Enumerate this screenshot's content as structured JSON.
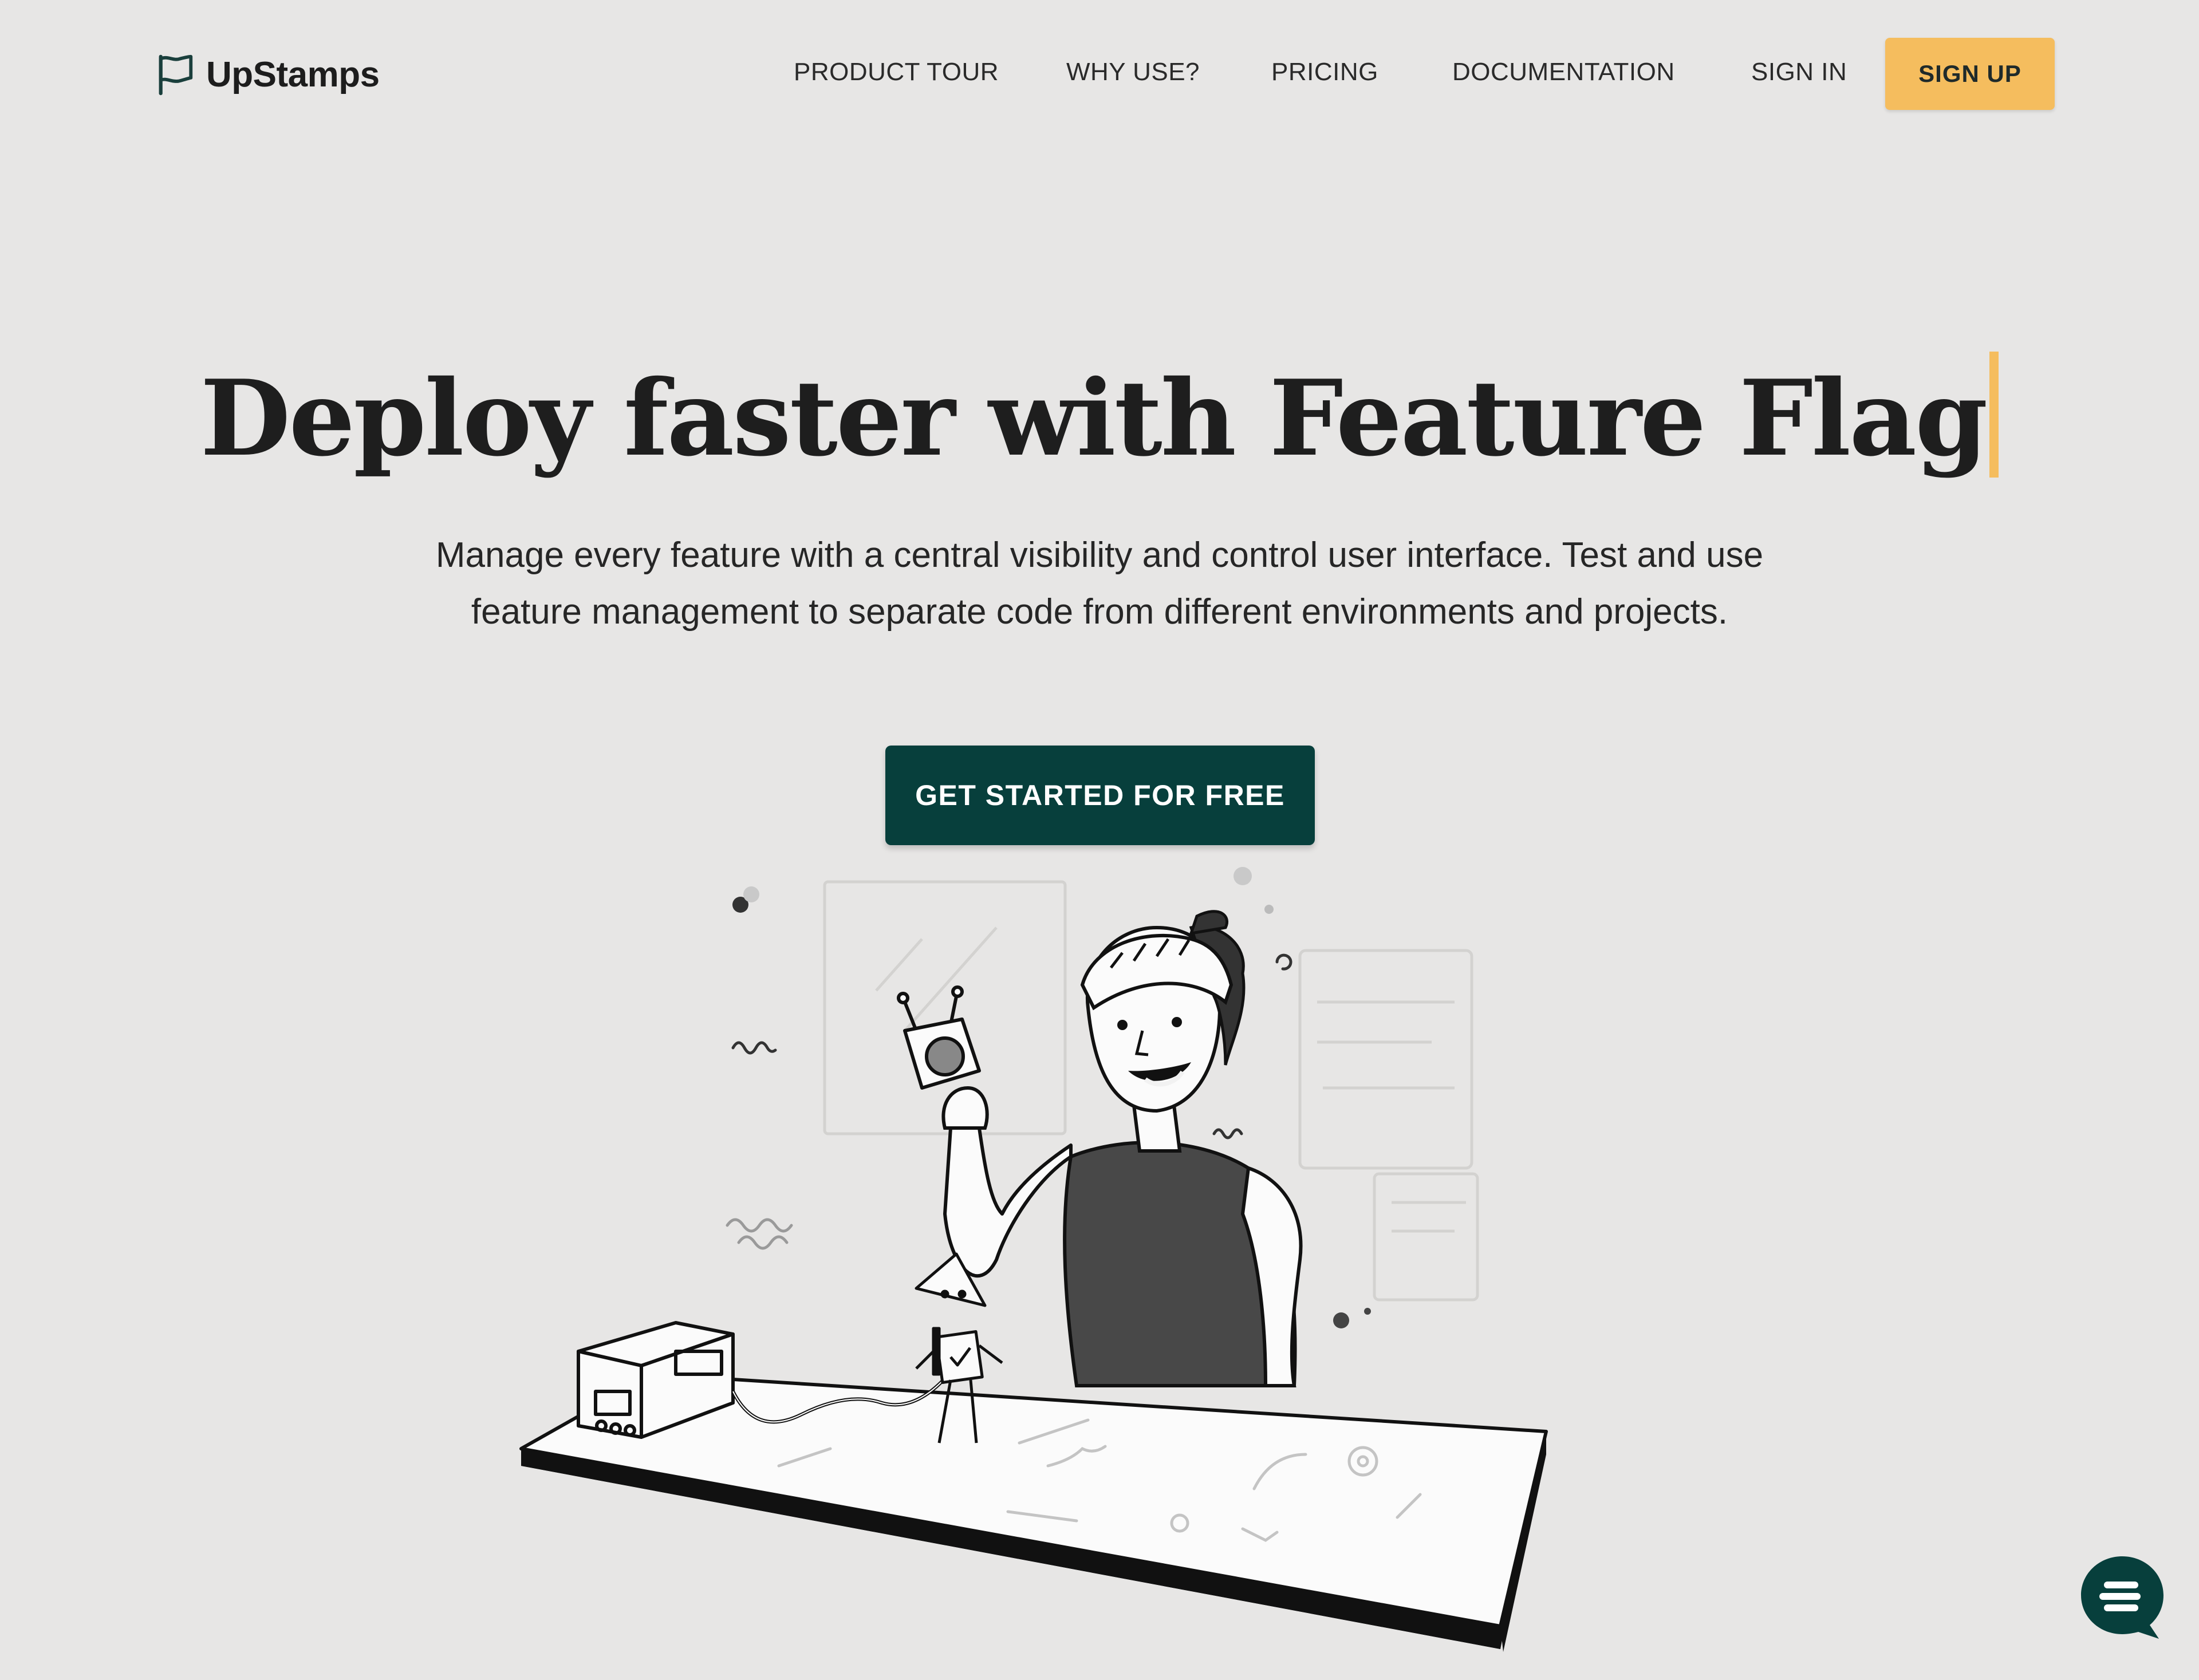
{
  "brand": {
    "name": "UpStamps",
    "icon": "flag-icon"
  },
  "nav": {
    "items": [
      {
        "label": "PRODUCT TOUR"
      },
      {
        "label": "WHY USE?"
      },
      {
        "label": "PRICING"
      },
      {
        "label": "DOCUMENTATION"
      },
      {
        "label": "SIGN IN"
      }
    ],
    "signup_label": "SIGN UP"
  },
  "hero": {
    "headline": "Deploy faster with Feature Flag",
    "subtitle": "Manage every feature with a central visibility and control user interface. Test and use feature management to separate code from different environments and projects.",
    "cta_label": "GET STARTED FOR FREE"
  },
  "chat": {
    "icon": "chat-bubble-icon"
  },
  "colors": {
    "background": "#e7e6e5",
    "accent": "#f5bd5e",
    "cta": "#073f3c",
    "text": "#1e1e1e"
  }
}
